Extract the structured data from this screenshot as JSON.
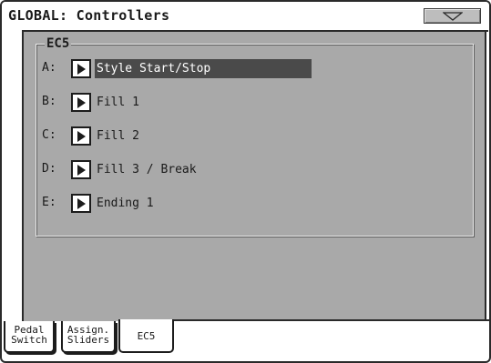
{
  "window": {
    "title": "GLOBAL: Controllers",
    "menu_icon": "triangle-down-icon"
  },
  "group": {
    "label": "EC5"
  },
  "assignments": [
    {
      "letter": "A:",
      "value": "Style Start/Stop",
      "selected": true
    },
    {
      "letter": "B:",
      "value": "Fill 1",
      "selected": false
    },
    {
      "letter": "C:",
      "value": "Fill 2",
      "selected": false
    },
    {
      "letter": "D:",
      "value": "Fill 3 / Break",
      "selected": false
    },
    {
      "letter": "E:",
      "value": "Ending 1",
      "selected": false
    }
  ],
  "tabs": [
    {
      "line1": "Pedal",
      "line2": "Switch",
      "active": false
    },
    {
      "line1": "Assign.",
      "line2": "Sliders",
      "active": false
    },
    {
      "line1": "EC5",
      "line2": "",
      "active": true
    }
  ],
  "colors": {
    "panel": "#a9a9a9",
    "selection": "#4a4a4a",
    "frame": "#2a2a2a"
  }
}
